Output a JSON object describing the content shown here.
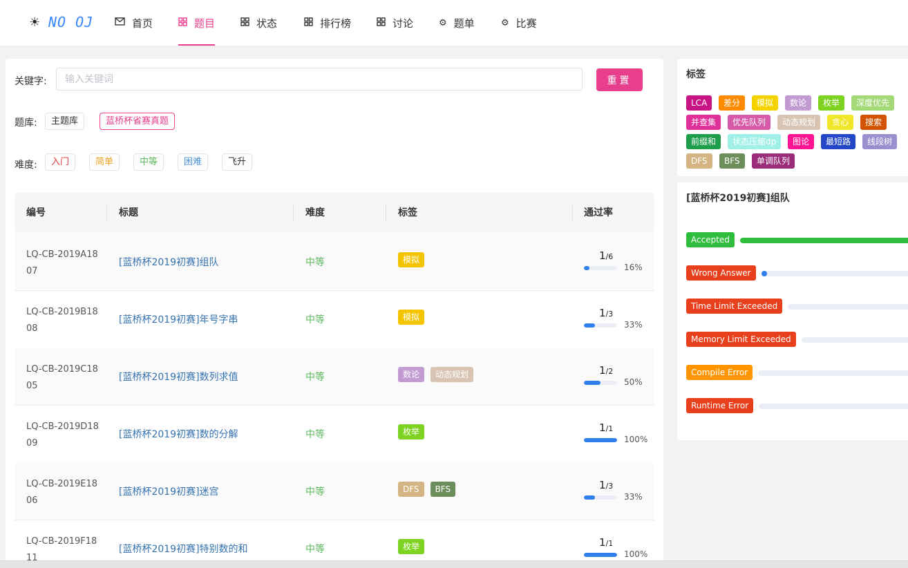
{
  "nav": {
    "logo_icon": "sun-icon",
    "logo": "NO OJ",
    "items": [
      {
        "label": "首页",
        "icon": "mail-icon",
        "active": false
      },
      {
        "label": "题目",
        "icon": "grid-icon",
        "active": true
      },
      {
        "label": "状态",
        "icon": "grid-icon",
        "active": false
      },
      {
        "label": "排行榜",
        "icon": "grid-icon",
        "active": false
      },
      {
        "label": "讨论",
        "icon": "grid-icon",
        "active": false
      },
      {
        "label": "题单",
        "icon": "gear-icon",
        "active": false
      },
      {
        "label": "比赛",
        "icon": "gear-icon",
        "active": false
      }
    ]
  },
  "filters": {
    "keyword_label": "关键字:",
    "keyword_placeholder": "输入关键词",
    "keyword_value": "",
    "reset_label": "重置",
    "bank_label": "题库:",
    "banks": [
      {
        "label": "主题库",
        "selected": false
      },
      {
        "label": "蓝桥杯省赛真题",
        "selected": true
      }
    ],
    "difficulty_label": "难度:",
    "difficulties": [
      {
        "label": "入门",
        "color": "#e5393b"
      },
      {
        "label": "简单",
        "color": "#f0a020"
      },
      {
        "label": "中等",
        "color": "#5cb85c"
      },
      {
        "label": "困难",
        "color": "#4a90d9"
      },
      {
        "label": "飞升",
        "color": "#333333"
      }
    ]
  },
  "table": {
    "headers": {
      "id": "编号",
      "title": "标题",
      "difficulty": "难度",
      "tags": "标签",
      "rate": "通过率"
    },
    "rows": [
      {
        "id": "LQ-CB-2019A1807",
        "title": "[蓝桥杯2019初赛]组队",
        "difficulty": "中等",
        "tags": [
          {
            "name": "模拟",
            "color": "#f5c400"
          }
        ],
        "passed": "1",
        "total": "6",
        "rate": 0.16,
        "pct": "16%"
      },
      {
        "id": "LQ-CB-2019B1808",
        "title": "[蓝桥杯2019初赛]年号字串",
        "difficulty": "中等",
        "tags": [
          {
            "name": "模拟",
            "color": "#f5c400"
          }
        ],
        "passed": "1",
        "total": "3",
        "rate": 0.33,
        "pct": "33%"
      },
      {
        "id": "LQ-CB-2019C1805",
        "title": "[蓝桥杯2019初赛]数列求值",
        "difficulty": "中等",
        "tags": [
          {
            "name": "数论",
            "color": "#c39bd3"
          },
          {
            "name": "动态规划",
            "color": "#d7c4b3"
          }
        ],
        "passed": "1",
        "total": "2",
        "rate": 0.5,
        "pct": "50%"
      },
      {
        "id": "LQ-CB-2019D1809",
        "title": "[蓝桥杯2019初赛]数的分解",
        "difficulty": "中等",
        "tags": [
          {
            "name": "枚举",
            "color": "#7ed321"
          }
        ],
        "passed": "1",
        "total": "1",
        "rate": 1.0,
        "pct": "100%"
      },
      {
        "id": "LQ-CB-2019E1806",
        "title": "[蓝桥杯2019初赛]迷宫",
        "difficulty": "中等",
        "tags": [
          {
            "name": "DFS",
            "color": "#d4b483"
          },
          {
            "name": "BFS",
            "color": "#6b8e5a"
          }
        ],
        "passed": "1",
        "total": "3",
        "rate": 0.33,
        "pct": "33%"
      },
      {
        "id": "LQ-CB-2019F1811",
        "title": "[蓝桥杯2019初赛]特别数的和",
        "difficulty": "中等",
        "tags": [
          {
            "name": "枚举",
            "color": "#7ed321"
          }
        ],
        "passed": "1",
        "total": "1",
        "rate": 1.0,
        "pct": "100%"
      }
    ]
  },
  "tag_panel": {
    "title": "标签",
    "rows": [
      [
        {
          "name": "LCA",
          "color": "#c71585"
        },
        {
          "name": "差分",
          "color": "#ff8c00"
        },
        {
          "name": "模拟",
          "color": "#f5d300"
        },
        {
          "name": "数论",
          "color": "#c39bd3"
        },
        {
          "name": "枚举",
          "color": "#7ed321"
        },
        {
          "name": "深度优先",
          "color": "#a3d977"
        }
      ],
      [
        {
          "name": "并查集",
          "color": "#e0309a"
        },
        {
          "name": "优先队列",
          "color": "#d65aa8"
        },
        {
          "name": "动态规划",
          "color": "#d7c4b3"
        },
        {
          "name": "贪心",
          "color": "#f0e62a"
        },
        {
          "name": "搜索",
          "color": "#d35400"
        }
      ],
      [
        {
          "name": "前缀和",
          "color": "#1e9e4a"
        },
        {
          "name": "状态压缩dp",
          "color": "#a0f0e8"
        },
        {
          "name": "图论",
          "color": "#ff1493"
        },
        {
          "name": "最短路",
          "color": "#2447c8"
        },
        {
          "name": "线段树",
          "color": "#9b8fd0"
        }
      ],
      [
        {
          "name": "DFS",
          "color": "#d4b483"
        },
        {
          "name": "BFS",
          "color": "#6b8e5a"
        },
        {
          "name": "单调队列",
          "color": "#9b2c7a"
        }
      ]
    ]
  },
  "stats": {
    "title": "[蓝桥杯2019初赛]组队",
    "items": [
      {
        "label": "Accepted",
        "color": "#2ebd3c",
        "value": 1
      },
      {
        "label": "Wrong Answer",
        "color": "#e8401c",
        "value": 0.04
      },
      {
        "label": "Time Limit Exceeded",
        "color": "#e8401c",
        "value": 0
      },
      {
        "label": "Memory Limit Exceeded",
        "color": "#e8401c",
        "value": 0
      },
      {
        "label": "Compile Error",
        "color": "#ff9500",
        "value": 0
      },
      {
        "label": "Runtime Error",
        "color": "#e8401c",
        "value": 0
      }
    ]
  }
}
